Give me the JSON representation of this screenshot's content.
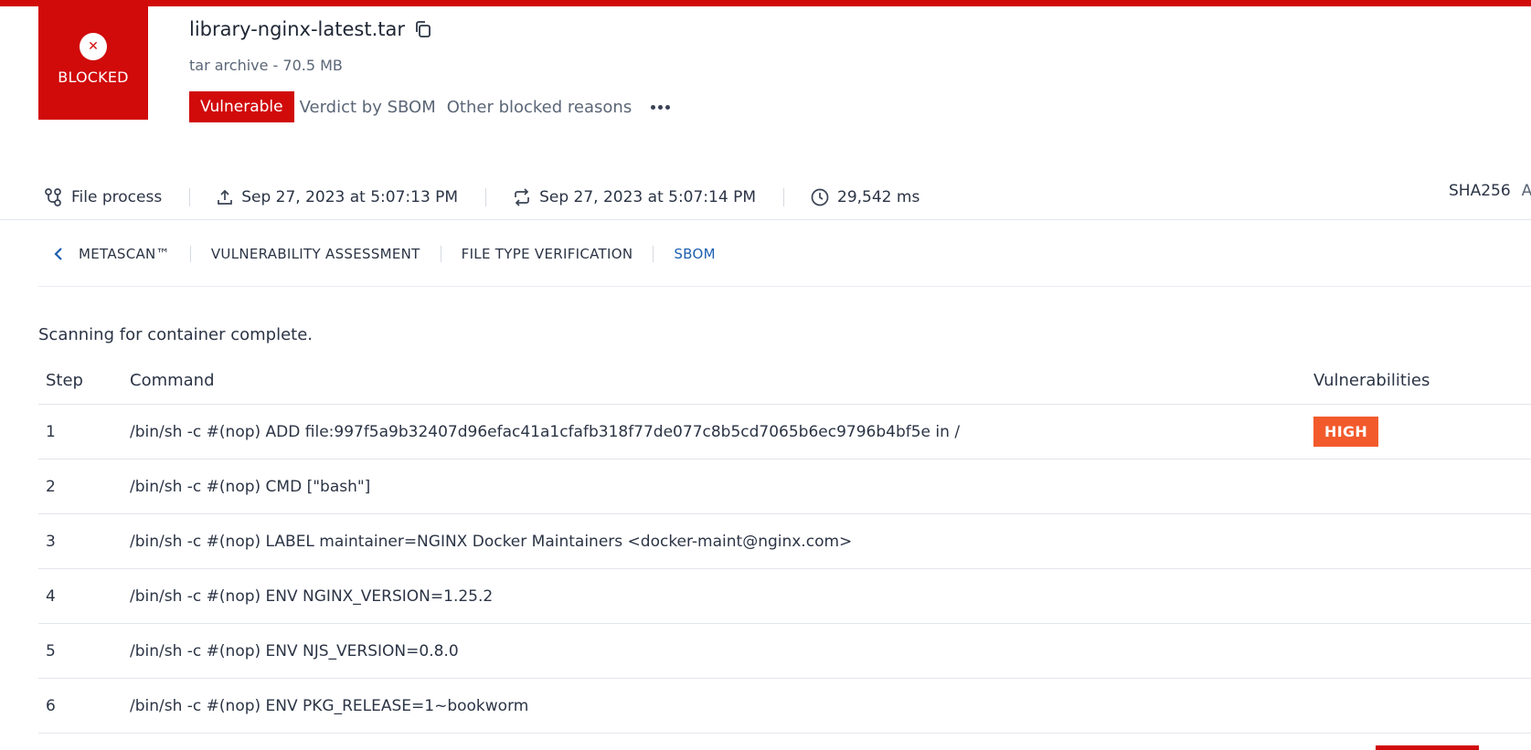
{
  "verdict": {
    "label": "BLOCKED",
    "icon": "close-circle-icon",
    "color": "#d10a0a"
  },
  "file": {
    "name": "library-nginx-latest.tar",
    "meta": "tar archive - 70.5 MB"
  },
  "tags": {
    "status": "Vulnerable",
    "verdict_by": "Verdict by SBOM",
    "other": "Other blocked reasons"
  },
  "info": {
    "process": "File process",
    "uploaded": "Sep 27, 2023 at 5:07:13 PM",
    "processed": "Sep 27, 2023 at 5:07:14 PM",
    "duration": "29,542 ms",
    "sha_label": "SHA256",
    "sha_clip": "A"
  },
  "tabs": {
    "items": [
      {
        "label": "METASCAN™"
      },
      {
        "label": "VULNERABILITY ASSESSMENT"
      },
      {
        "label": "FILE TYPE VERIFICATION"
      },
      {
        "label": "SBOM"
      }
    ],
    "active": "SBOM"
  },
  "scan_status": "Scanning for container complete.",
  "table": {
    "headers": {
      "step": "Step",
      "command": "Command",
      "vulnerabilities": "Vulnerabilities"
    },
    "rows": [
      {
        "step": "1",
        "command": "/bin/sh -c #(nop) ADD file:997f5a9b32407d96efac41a1cfafb318f77de077c8b5cd7065b6ec9796b4bf5e in /",
        "vuln": "HIGH"
      },
      {
        "step": "2",
        "command": "/bin/sh -c #(nop) CMD [\"bash\"]",
        "vuln": ""
      },
      {
        "step": "3",
        "command": "/bin/sh -c #(nop) LABEL maintainer=NGINX Docker Maintainers <docker-maint@nginx.com>",
        "vuln": ""
      },
      {
        "step": "4",
        "command": "/bin/sh -c #(nop) ENV NGINX_VERSION=1.25.2",
        "vuln": ""
      },
      {
        "step": "5",
        "command": "/bin/sh -c #(nop) ENV NJS_VERSION=0.8.0",
        "vuln": ""
      },
      {
        "step": "6",
        "command": "/bin/sh -c #(nop) ENV PKG_RELEASE=1~bookworm",
        "vuln": ""
      }
    ]
  },
  "colors": {
    "brand_red": "#d10a0a",
    "high": "#f25a2c",
    "active_tab": "#1d5fb0"
  }
}
